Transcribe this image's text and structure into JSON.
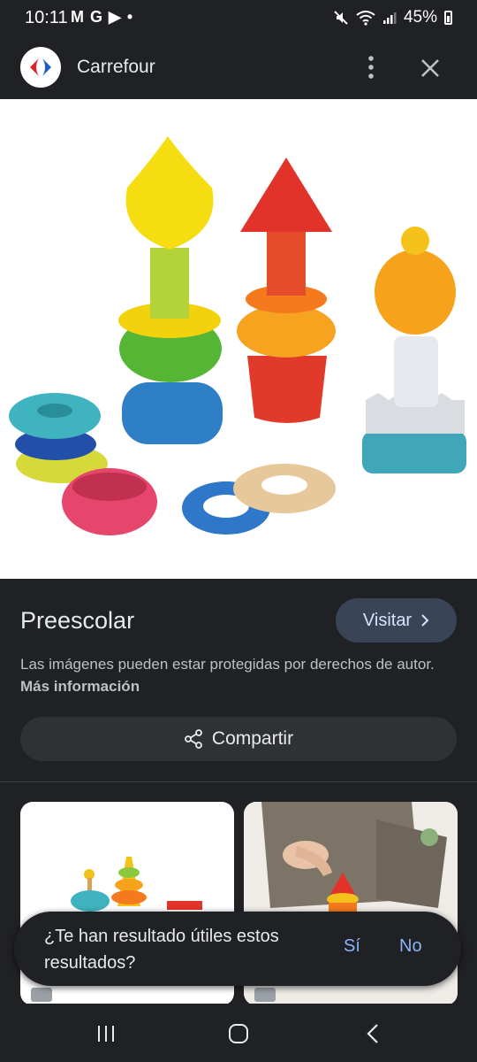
{
  "status_bar": {
    "time": "10:11",
    "notification_icons": "M G ▶ •",
    "battery": "45%"
  },
  "header": {
    "site_name": "Carrefour",
    "logo_icon": "carrefour-logo",
    "menu_icon": "more-vert-icon",
    "close_icon": "close-icon"
  },
  "result": {
    "title": "Preescolar",
    "visit_label": "Visitar",
    "copyright_text": "Las imágenes pueden estar protegidas por derechos de autor.",
    "more_info_link": "Más información",
    "share_label": "Compartir"
  },
  "feedback": {
    "question": "¿Te han resultado útiles estos resultados?",
    "yes": "Sí",
    "no": "No"
  },
  "colors": {
    "background": "#202124",
    "accent": "#8ab4f8",
    "visit_button": "#394457"
  }
}
